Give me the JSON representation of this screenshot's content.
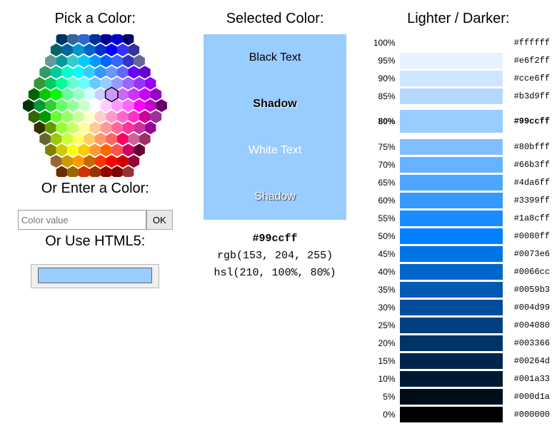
{
  "headings": {
    "pick": "Pick a Color:",
    "selected": "Selected Color:",
    "shade": "Lighter / Darker:",
    "enter": "Or Enter a Color:",
    "html5": "Or Use HTML5:"
  },
  "input": {
    "placeholder": "Color value",
    "ok": "OK"
  },
  "selected": {
    "color": "#99ccff",
    "blackText": "Black Text",
    "shadow1": "Shadow",
    "whiteText": "White Text",
    "shadow2": "Shadow",
    "hex": "#99ccff",
    "rgb": "rgb(153, 204, 255)",
    "hsl": "hsl(210, 100%, 80%)"
  },
  "shades": [
    {
      "pct": "100%",
      "hex": "#ffffff",
      "current": false
    },
    {
      "pct": "95%",
      "hex": "#e6f2ff",
      "current": false
    },
    {
      "pct": "90%",
      "hex": "#cce6ff",
      "current": false
    },
    {
      "pct": "85%",
      "hex": "#b3d9ff",
      "current": false
    },
    {
      "pct": "80%",
      "hex": "#99ccff",
      "current": true
    },
    {
      "pct": "75%",
      "hex": "#80bfff",
      "current": false
    },
    {
      "pct": "70%",
      "hex": "#66b3ff",
      "current": false
    },
    {
      "pct": "65%",
      "hex": "#4da6ff",
      "current": false
    },
    {
      "pct": "60%",
      "hex": "#3399ff",
      "current": false
    },
    {
      "pct": "55%",
      "hex": "#1a8cff",
      "current": false
    },
    {
      "pct": "50%",
      "hex": "#0080ff",
      "current": false
    },
    {
      "pct": "45%",
      "hex": "#0073e6",
      "current": false
    },
    {
      "pct": "40%",
      "hex": "#0066cc",
      "current": false
    },
    {
      "pct": "35%",
      "hex": "#0059b3",
      "current": false
    },
    {
      "pct": "30%",
      "hex": "#004d99",
      "current": false
    },
    {
      "pct": "25%",
      "hex": "#004080",
      "current": false
    },
    {
      "pct": "20%",
      "hex": "#003366",
      "current": false
    },
    {
      "pct": "15%",
      "hex": "#00264d",
      "current": false
    },
    {
      "pct": "10%",
      "hex": "#001a33",
      "current": false
    },
    {
      "pct": "5%",
      "hex": "#000d1a",
      "current": false
    },
    {
      "pct": "0%",
      "hex": "#000000",
      "current": false
    }
  ],
  "hex_colors": [
    "#003366",
    "#336699",
    "#3366CC",
    "#003399",
    "#000099",
    "#0000CC",
    "#000066",
    "#006666",
    "#006699",
    "#0099CC",
    "#0066CC",
    "#0033CC",
    "#0000FF",
    "#3333FF",
    "#333399",
    "#669999",
    "#009999",
    "#33CCCC",
    "#00CCFF",
    "#0099FF",
    "#0066FF",
    "#3366FF",
    "#3333CC",
    "#666699",
    "#339966",
    "#00CC99",
    "#00FFCC",
    "#00FFFF",
    "#33CCFF",
    "#3399FF",
    "#6699FF",
    "#6666FF",
    "#6600FF",
    "#6600CC",
    "#339933",
    "#00CC66",
    "#00FF99",
    "#66FFCC",
    "#66FFFF",
    "#66CCFF",
    "#99CCFF",
    "#9999FF",
    "#9966FF",
    "#9933FF",
    "#9900FF",
    "#006600",
    "#00CC00",
    "#00FF00",
    "#66FF99",
    "#99FFCC",
    "#CCFFFF",
    "#CCCCFF",
    "#CC99FF",
    "#CC66FF",
    "#CC33FF",
    "#CC00FF",
    "#9900CC",
    "#003300",
    "#009933",
    "#33CC33",
    "#66FF66",
    "#99FF99",
    "#CCFFCC",
    "#FFFFFF",
    "#FFCCFF",
    "#FF99FF",
    "#FF66FF",
    "#FF00FF",
    "#CC00CC",
    "#660066",
    "#336600",
    "#009900",
    "#66FF33",
    "#99FF66",
    "#CCFF99",
    "#FFFFCC",
    "#FFCCCC",
    "#FF99CC",
    "#FF66CC",
    "#FF33CC",
    "#CC0099",
    "#993399",
    "#333300",
    "#669900",
    "#99FF33",
    "#CCFF66",
    "#FFFF99",
    "#FFCC99",
    "#FF9999",
    "#FF6699",
    "#FF3399",
    "#CC3399",
    "#990099",
    "#666633",
    "#99CC00",
    "#CCFF33",
    "#FFFF66",
    "#FFCC66",
    "#FF9966",
    "#FF6666",
    "#FF0066",
    "#CC6699",
    "#993366",
    "#808000",
    "#CCCC00",
    "#FFFF00",
    "#FFCC00",
    "#FF9933",
    "#FF6600",
    "#FF5050",
    "#CC0066",
    "#660033",
    "#996633",
    "#CC9900",
    "#FF9900",
    "#CC6600",
    "#FF3300",
    "#FF0000",
    "#CC0000",
    "#990033",
    "#663300",
    "#996600",
    "#CC3300",
    "#993300",
    "#990000",
    "#800000",
    "#993333"
  ],
  "hex_row_counts": [
    7,
    8,
    9,
    10,
    11,
    12,
    13,
    12,
    11,
    10,
    9,
    8,
    7
  ],
  "marker_pos": {
    "row": 5,
    "col": 7
  }
}
